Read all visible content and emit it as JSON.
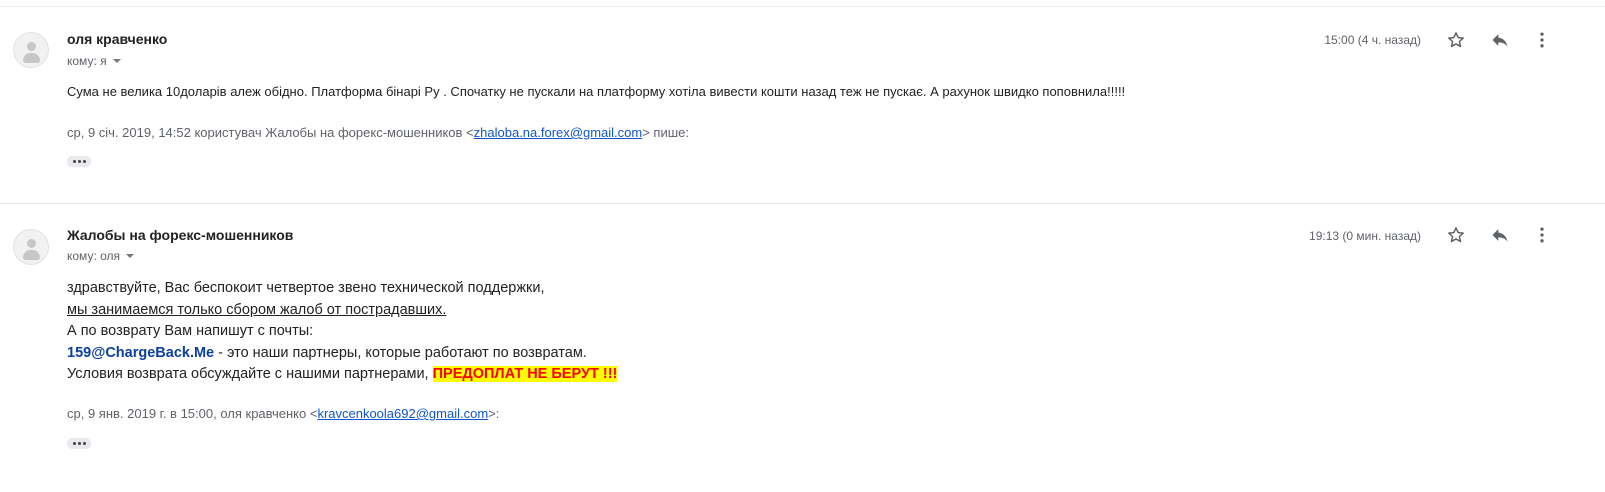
{
  "messages": [
    {
      "sender": "оля кравченко",
      "to_label": "кому: я",
      "time": "15:00 (4 ч. назад)",
      "body": "Сума не велика 10доларів алеж обідно. Платформа бінарі Ру . Спочатку не пускали на платформу хотіла вивести кошти назад теж не пускає. А рахунок швидко поповнила!!!!!",
      "quote_prefix": "ср, 9 січ. 2019, 14:52 користувач Жалобы на форекс-мошенников <",
      "quote_email": "zhaloba.na.forex@gmail.com",
      "quote_suffix": "> пише:"
    },
    {
      "sender": "Жалобы на форекс-мошенников",
      "to_label": "кому: оля",
      "time": "19:13 (0 мин. назад)",
      "lines": {
        "l1": "здравствуйте, Вас беспокоит четвертое звено технической поддержки,",
        "l2": "мы занимаемся только сбором жалоб от пострадавших.",
        "l3": "А по возврату Вам напишут с почты:",
        "l4_email": "159@ChargeBack.Me",
        "l4_rest": " - это наши партнеры, которые работают по возвратам.",
        "l5_text": "Условия возврата обсуждайте с нашими партнерами, ",
        "l5_highlight": "ПРЕДОПЛАТ НЕ БЕРУТ !!!"
      },
      "quote_prefix": "ср, 9 янв. 2019 г. в 15:00, оля кравченко <",
      "quote_email": "kravcenkoola692@gmail.com",
      "quote_suffix": ">:"
    }
  ],
  "icons": {
    "star": "star-outline-icon",
    "reply": "reply-arrow-icon",
    "more": "more-vertical-icon",
    "avatar": "default-avatar-icon",
    "expand": "ellipsis-icon"
  },
  "colors": {
    "link": "#1155cc",
    "partner_email": "#0b3fa1",
    "warning_text": "#ff0000",
    "warning_bg": "#ffff00"
  }
}
